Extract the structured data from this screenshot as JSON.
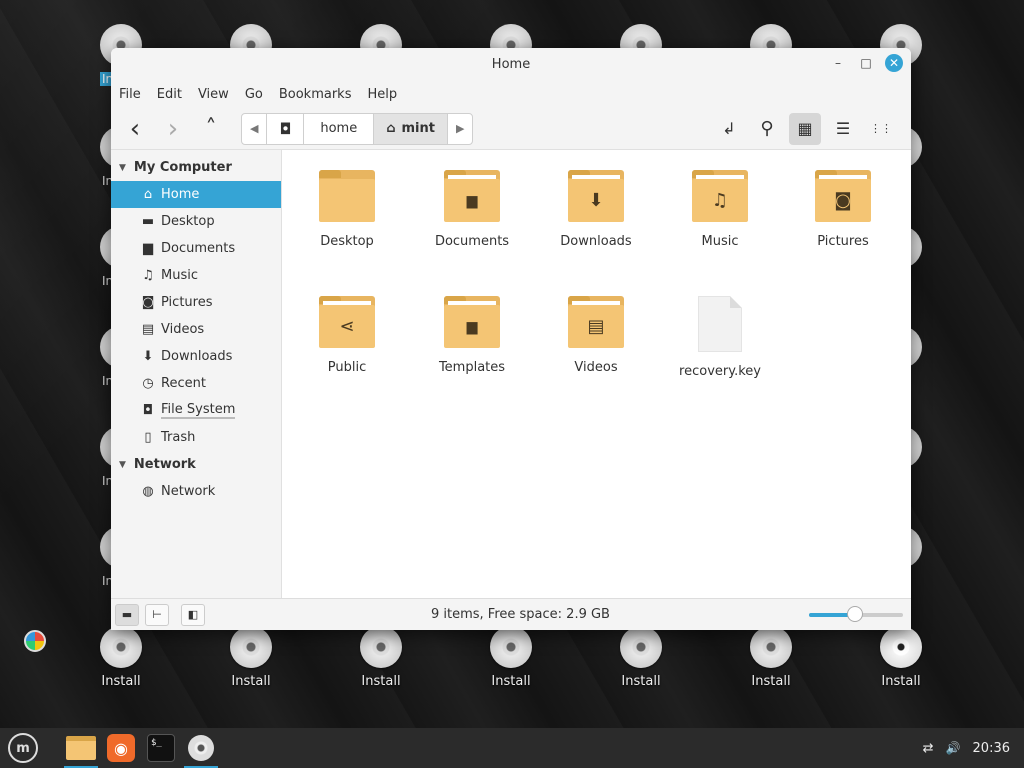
{
  "window": {
    "title": "Home",
    "minimize": "–",
    "maximize": "□",
    "close": "✕"
  },
  "menu": [
    "File",
    "Edit",
    "View",
    "Go",
    "Bookmarks",
    "Help"
  ],
  "toolbar": {
    "back_icon": "‹",
    "forward_icon": "›",
    "up_icon": "˄",
    "path": {
      "left_arrow": "◀",
      "root_icon": "◘",
      "segments": [
        "home",
        "mint"
      ],
      "home_glyph": "⌂",
      "right_arrow": "▶"
    },
    "toggle_location_icon": "↲",
    "search_icon": "⚲",
    "icon_view_icon": "▦",
    "list_view_icon": "☰",
    "compact_view_icon": "⋮⋮"
  },
  "sidebar": {
    "sections": [
      {
        "title": "My Computer",
        "items": [
          {
            "label": "Home",
            "icon": "home-icon",
            "glyph": "⌂"
          },
          {
            "label": "Desktop",
            "icon": "desktop-icon",
            "glyph": "▬"
          },
          {
            "label": "Documents",
            "icon": "document-icon",
            "glyph": "▆"
          },
          {
            "label": "Music",
            "icon": "music-icon",
            "glyph": "♫"
          },
          {
            "label": "Pictures",
            "icon": "camera-icon",
            "glyph": "◙"
          },
          {
            "label": "Videos",
            "icon": "film-icon",
            "glyph": "▤"
          },
          {
            "label": "Downloads",
            "icon": "download-icon",
            "glyph": "⬇"
          },
          {
            "label": "Recent",
            "icon": "clock-icon",
            "glyph": "◷"
          },
          {
            "label": "File System",
            "icon": "drive-icon",
            "glyph": "◘"
          },
          {
            "label": "Trash",
            "icon": "trash-icon",
            "glyph": "▯"
          }
        ]
      },
      {
        "title": "Network",
        "items": [
          {
            "label": "Network",
            "icon": "globe-icon",
            "glyph": "◍"
          }
        ]
      }
    ]
  },
  "files": [
    {
      "name": "Desktop",
      "type": "folder",
      "emblem": ""
    },
    {
      "name": "Documents",
      "type": "folder",
      "emblem": "▆"
    },
    {
      "name": "Downloads",
      "type": "folder",
      "emblem": "⬇"
    },
    {
      "name": "Music",
      "type": "folder",
      "emblem": "♫"
    },
    {
      "name": "Pictures",
      "type": "folder",
      "emblem": "◙"
    },
    {
      "name": "Public",
      "type": "folder",
      "emblem": "⋖"
    },
    {
      "name": "Templates",
      "type": "folder",
      "emblem": "▆"
    },
    {
      "name": "Videos",
      "type": "folder",
      "emblem": "▤"
    },
    {
      "name": "recovery.key",
      "type": "file",
      "emblem": ""
    }
  ],
  "statusbar": {
    "text": "9 items, Free space: 2.9 GB",
    "zoom_level": 0.49
  },
  "desktop": {
    "icons_bottom": [
      "Install",
      "Install",
      "Install",
      "Install",
      "Install",
      "Install",
      "Install",
      "Install"
    ],
    "partial_label": "In",
    "partial_label_top": "In"
  },
  "taskbar": {
    "menu_glyph": "m",
    "terminal_text": "$_",
    "clock": "20:36",
    "volume_glyph": "🔊",
    "network_glyph": "⇄"
  },
  "colors": {
    "accent": "#35a4d5",
    "folder": "#f4c574"
  }
}
